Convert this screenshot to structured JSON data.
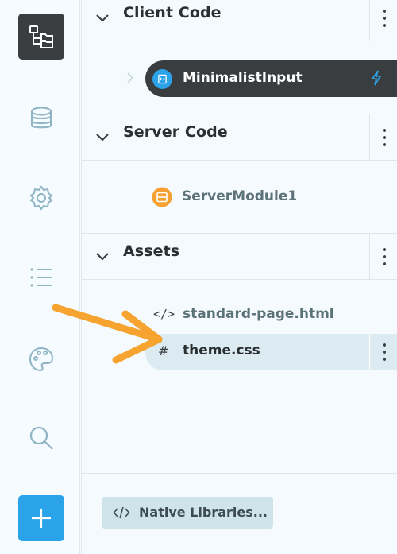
{
  "rail": {
    "items": [
      {
        "name": "app-tree-icon",
        "active": true
      },
      {
        "name": "database-icon"
      },
      {
        "name": "settings-icon"
      },
      {
        "name": "list-icon"
      },
      {
        "name": "palette-icon"
      },
      {
        "name": "search-icon"
      },
      {
        "name": "add-icon"
      }
    ]
  },
  "client_code": {
    "title": "Client Code",
    "items": [
      {
        "label": "MinimalistInput",
        "icon": "form-icon",
        "badge": "lightning-icon",
        "selected": true
      }
    ]
  },
  "server_code": {
    "title": "Server Code",
    "items": [
      {
        "label": "ServerModule1",
        "icon": "server-module-icon"
      }
    ]
  },
  "assets": {
    "title": "Assets",
    "items": [
      {
        "label": "standard-page.html",
        "icon": "code-icon",
        "glyph": "</>"
      },
      {
        "label": "theme.css",
        "icon": "hash-icon",
        "glyph": "#",
        "selected": true
      }
    ]
  },
  "footer": {
    "native_libraries_label": "Native Libraries..."
  },
  "colors": {
    "accent": "#2ba3ea",
    "orange": "#f6a031",
    "dark": "#3a3d40",
    "annotation_arrow": "#f7a32f"
  }
}
